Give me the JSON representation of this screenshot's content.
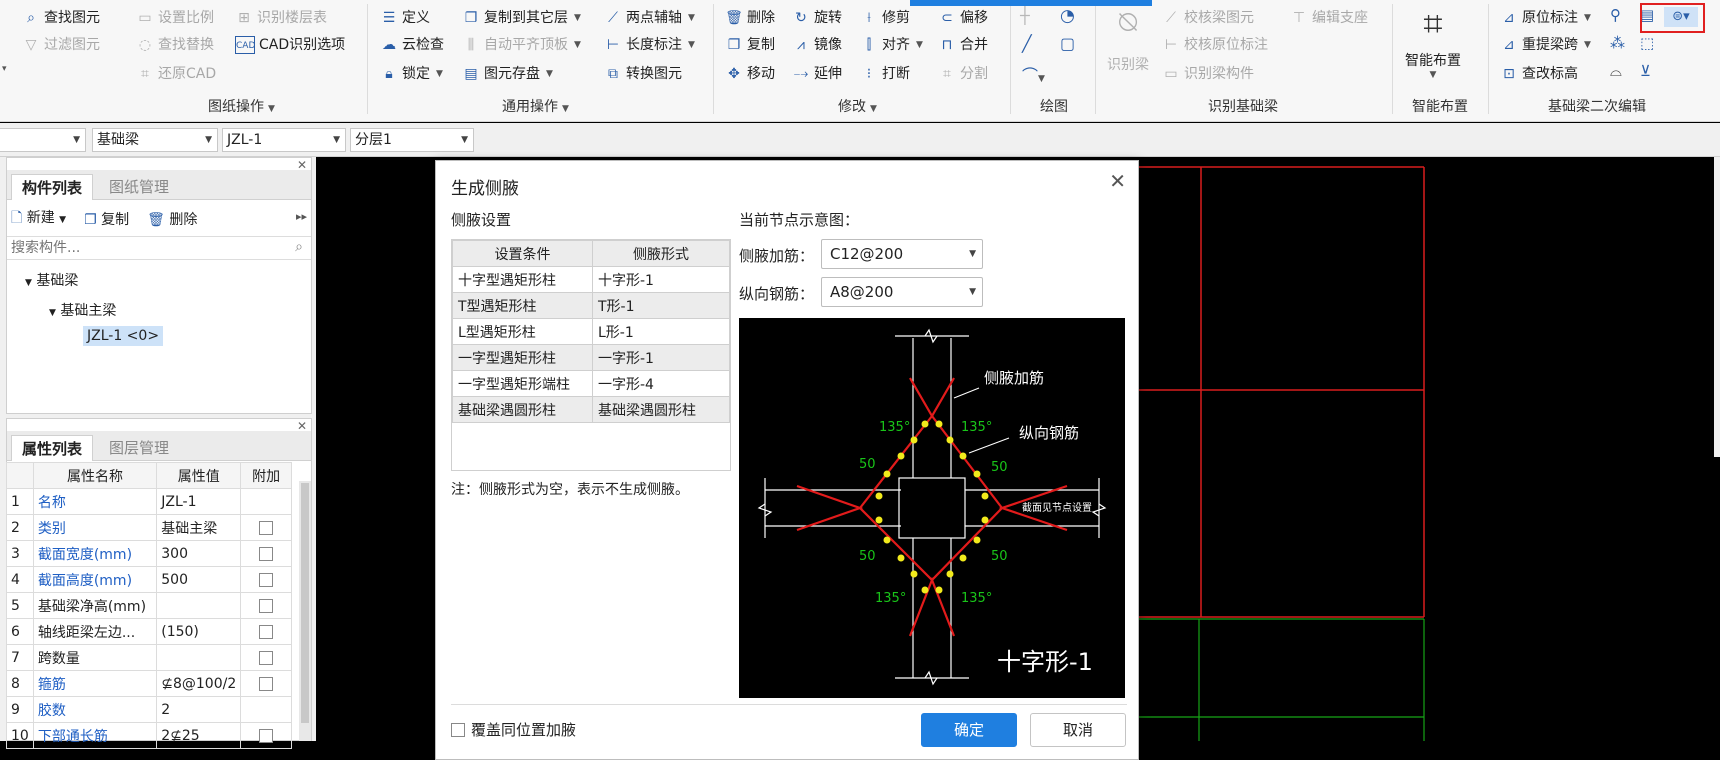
{
  "ribbon": {
    "col1": [
      "查找图元",
      "过滤图元"
    ],
    "col2": [
      "设置比例",
      "查找替换",
      "还原CAD"
    ],
    "col3": [
      "识别楼层表",
      "CAD识别选项"
    ],
    "group_drawing_ops": "图纸操作",
    "col4": [
      "定义",
      "云检查",
      "锁定"
    ],
    "col5": [
      "复制到其它层",
      "自动平齐顶板",
      "图元存盘"
    ],
    "col6": [
      "两点辅轴",
      "长度标注",
      "转换图元"
    ],
    "group_general_ops": "通用操作",
    "col7": [
      "删除",
      "复制",
      "移动"
    ],
    "col8": [
      "旋转",
      "镜像",
      "延伸"
    ],
    "col9": [
      "修剪",
      "对齐",
      "打断"
    ],
    "col10": [
      "偏移",
      "合并",
      "分割"
    ],
    "group_modify": "修改",
    "group_draw": "绘图",
    "recognize_beam": "识别梁",
    "col11": [
      "校核梁图元",
      "校核原位标注",
      "识别梁构件"
    ],
    "edit_support": "编辑支座",
    "group_recognize": "识别基础梁",
    "smart_layout": "智能布置",
    "group_smart": "智能布置",
    "col12": [
      "原位标注",
      "重提梁跨",
      "查改标高"
    ],
    "group_secondary": "基础梁二次编辑"
  },
  "toolbar2": {
    "combo1": "",
    "combo2": "基础梁",
    "combo3": "JZL-1",
    "combo4": "分层1"
  },
  "component_panel": {
    "tab_active": "构件列表",
    "tab_other": "图纸管理",
    "new": "新建",
    "copy": "复制",
    "delete": "删除",
    "search_placeholder": "搜索构件...",
    "tree_root": "基础梁",
    "tree_child": "基础主梁",
    "tree_leaf": "JZL-1 <0>"
  },
  "property_panel": {
    "tab_active": "属性列表",
    "tab_other": "图层管理",
    "headers": [
      "",
      "属性名称",
      "属性值",
      "附加"
    ],
    "rows": [
      {
        "n": "1",
        "name": "名称",
        "value": "JZL-1",
        "blue": true,
        "check": false
      },
      {
        "n": "2",
        "name": "类别",
        "value": "基础主梁",
        "blue": true,
        "check": true
      },
      {
        "n": "3",
        "name": "截面宽度(mm)",
        "value": "300",
        "blue": true,
        "check": true
      },
      {
        "n": "4",
        "name": "截面高度(mm)",
        "value": "500",
        "blue": true,
        "check": true
      },
      {
        "n": "5",
        "name": "基础梁净高(mm)",
        "value": "",
        "blue": false,
        "check": true
      },
      {
        "n": "6",
        "name": "轴线距梁左边...",
        "value": "(150)",
        "blue": false,
        "check": true
      },
      {
        "n": "7",
        "name": "跨数量",
        "value": "",
        "blue": false,
        "check": true
      },
      {
        "n": "8",
        "name": "箍筋",
        "value": "⊈8@100/2",
        "blue": true,
        "check": true
      },
      {
        "n": "9",
        "name": "胶数",
        "value": "2",
        "blue": true,
        "check": false
      },
      {
        "n": "10",
        "name": "下部通长筋",
        "value": "2⊈25",
        "blue": true,
        "check": true
      }
    ]
  },
  "dialog": {
    "title": "生成侧腋",
    "settings_label": "侧腋设置",
    "col_condition": "设置条件",
    "col_form": "侧腋形式",
    "rows": [
      {
        "cond": "十字型遇矩形柱",
        "form": "十字形-1"
      },
      {
        "cond": "T型遇矩形柱",
        "form": "T形-1"
      },
      {
        "cond": "L型遇矩形柱",
        "form": "L形-1"
      },
      {
        "cond": "一字型遇矩形柱",
        "form": "一字形-1"
      },
      {
        "cond": "一字型遇矩形端柱",
        "form": "一字形-4"
      },
      {
        "cond": "基础梁遇圆形柱",
        "form": "基础梁遇圆形柱"
      }
    ],
    "note": "注：侧腋形式为空，表示不生成侧腋。",
    "preview_label": "当前节点示意图：",
    "side_rebar_label": "侧腋加筋：",
    "side_rebar_value": "C12@200",
    "long_rebar_label": "纵向钢筋：",
    "long_rebar_value": "A8@200",
    "diagram_label_side": "侧腋加筋",
    "diagram_label_long": "纵向钢筋",
    "diagram_label_section": "截面见节点设置",
    "diagram_angle": "135°",
    "diagram_dim": "50",
    "diagram_title": "十字形-1",
    "overwrite_label": "覆盖同位置加腋",
    "ok": "确定",
    "cancel": "取消"
  }
}
